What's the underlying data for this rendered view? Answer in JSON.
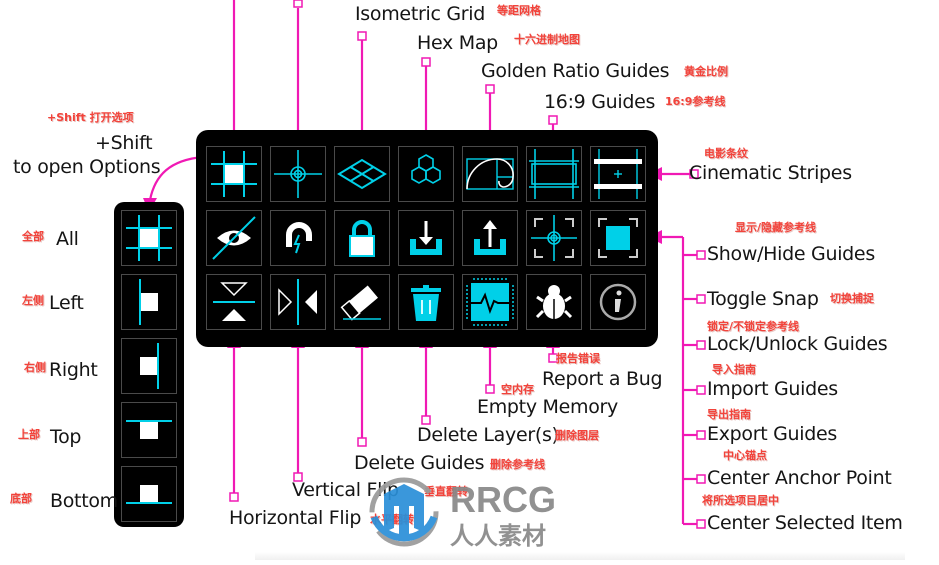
{
  "top_labels": {
    "isometric_grid": {
      "en": "Isometric Grid",
      "cn": "等距网格"
    },
    "hex_map": {
      "en": "Hex Map",
      "cn": "十六进制地图"
    },
    "golden_ratio": {
      "en": "Golden Ratio Guides",
      "cn": "黄金比例"
    },
    "guides_16_9": {
      "en": "16:9 Guides",
      "cn": "16:9参考线"
    }
  },
  "shift_note": {
    "cn": "+Shift 打开选项",
    "line1": "+Shift",
    "line2": "to open Options"
  },
  "right_labels": {
    "cinematic": {
      "en": "Cinematic Stripes",
      "cn": "电影条纹"
    },
    "show_hide": {
      "en": "Show/Hide Guides",
      "cn": "显示/隐藏参考线"
    },
    "toggle_snap": {
      "en": "Toggle Snap",
      "cn": "切换捕捉"
    },
    "lock_unlock": {
      "en": "Lock/Unlock Guides",
      "cn": "锁定/不锁定参考线"
    },
    "import": {
      "en": "Import Guides",
      "cn": "导入指南"
    },
    "export": {
      "en": "Export Guides",
      "cn": "导出指南"
    },
    "center_anchor": {
      "en": "Center Anchor Point",
      "cn": "中心锚点"
    },
    "center_selected": {
      "en": "Center Selected Item",
      "cn": "将所选项目居中"
    }
  },
  "bottom_labels": {
    "report_bug": {
      "en": "Report a Bug",
      "cn": "报告错误"
    },
    "empty_memory": {
      "en": "Empty Memory",
      "cn": "空内存"
    },
    "delete_layers": {
      "en": "Delete Layer(s)",
      "cn": "删除图层"
    },
    "delete_guides": {
      "en": "Delete Guides",
      "cn": "删除参考线"
    },
    "vertical_flip": {
      "en": "Vertical Flip",
      "cn": "垂直翻转"
    },
    "horizontal_flip": {
      "en": "Horizontal Flip",
      "cn": "水平翻转"
    }
  },
  "options_labels": [
    {
      "en": "All",
      "cn": "全部"
    },
    {
      "en": "Left",
      "cn": "左侧"
    },
    {
      "en": "Right",
      "cn": "右侧"
    },
    {
      "en": "Top",
      "cn": "上部"
    },
    {
      "en": "Bottom",
      "cn": "底部"
    }
  ],
  "grid_icons": [
    [
      "grid-all-icon",
      "crosshair-icon",
      "isometric-grid-icon",
      "hex-map-icon",
      "golden-ratio-icon",
      "guides-16-9-icon",
      "cinematic-stripes-icon"
    ],
    [
      "show-hide-guides-icon",
      "snap-magnet-icon",
      "lock-icon",
      "import-icon",
      "export-icon",
      "center-anchor-icon",
      "center-selected-icon"
    ],
    [
      "horizontal-flip-icon",
      "vertical-flip-icon",
      "eraser-icon",
      "trash-icon",
      "memory-chip-icon",
      "bug-icon",
      "info-icon"
    ]
  ],
  "watermark": {
    "brand": "RRCG",
    "sub": "人人素材"
  },
  "colors": {
    "accent": "#00d0e8",
    "connector": "#f019b4",
    "panel": "#000000",
    "cn_label": "#f2433b"
  }
}
